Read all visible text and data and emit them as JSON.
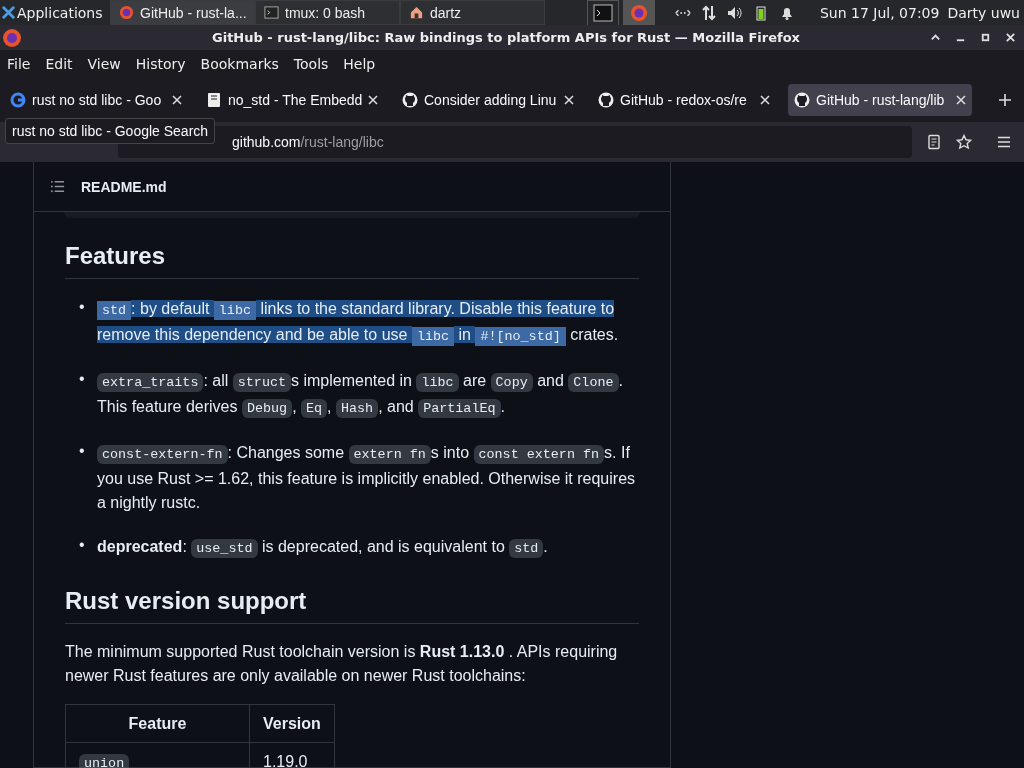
{
  "taskbar": {
    "apps_label": "Applications",
    "tasks": [
      {
        "title": "GitHub - rust-la...",
        "selected": true
      },
      {
        "title": "tmux: 0 bash",
        "selected": false
      },
      {
        "title": "dartz",
        "selected": false
      }
    ],
    "clock": "Sun 17 Jul, 07:09",
    "user": "Darty uwu"
  },
  "window": {
    "title": "GitHub - rust-lang/libc: Raw bindings to platform APIs for Rust — Mozilla Firefox"
  },
  "menu": [
    "File",
    "Edit",
    "View",
    "History",
    "Bookmarks",
    "Tools",
    "Help"
  ],
  "tabs": [
    {
      "title": "rust no std libc - Goo",
      "selected": false
    },
    {
      "title": "no_std - The Embedd",
      "selected": false
    },
    {
      "title": "Consider adding Linu",
      "selected": false
    },
    {
      "title": "GitHub - redox-os/re",
      "selected": false
    },
    {
      "title": "GitHub - rust-lang/lib",
      "selected": true
    }
  ],
  "tooltip": "rust no std libc - Google Search",
  "address": {
    "host": "github.com",
    "path": "/rust-lang/libc"
  },
  "readme": {
    "file": "README.md",
    "features_heading": "Features",
    "features": [
      {
        "bullet": "•",
        "selected": true,
        "parts": [
          {
            "kind": "code",
            "text": "std"
          },
          {
            "kind": "text",
            "text": ": by default "
          },
          {
            "kind": "code",
            "text": "libc"
          },
          {
            "kind": "text",
            "text": " links to the standard library. Disable this feature to remove this dependency and be able to use "
          },
          {
            "kind": "code",
            "text": "libc"
          },
          {
            "kind": "text",
            "text": " in "
          },
          {
            "kind": "code",
            "text": "#![no_std]"
          },
          {
            "kind": "plain",
            "text": " crates."
          }
        ]
      },
      {
        "bullet": "•",
        "selected": false,
        "parts": [
          {
            "kind": "code",
            "text": "extra_traits"
          },
          {
            "kind": "text",
            "text": ": all "
          },
          {
            "kind": "code",
            "text": "struct"
          },
          {
            "kind": "text",
            "text": "s implemented in "
          },
          {
            "kind": "code",
            "text": "libc"
          },
          {
            "kind": "text",
            "text": " are "
          },
          {
            "kind": "code",
            "text": "Copy"
          },
          {
            "kind": "text",
            "text": " and "
          },
          {
            "kind": "code",
            "text": "Clone"
          },
          {
            "kind": "text",
            "text": ". This feature derives "
          },
          {
            "kind": "code",
            "text": "Debug"
          },
          {
            "kind": "text",
            "text": ", "
          },
          {
            "kind": "code",
            "text": "Eq"
          },
          {
            "kind": "text",
            "text": ", "
          },
          {
            "kind": "code",
            "text": "Hash"
          },
          {
            "kind": "text",
            "text": ", and "
          },
          {
            "kind": "code",
            "text": "PartialEq"
          },
          {
            "kind": "text",
            "text": "."
          }
        ]
      },
      {
        "bullet": "•",
        "selected": false,
        "parts": [
          {
            "kind": "code",
            "text": "const-extern-fn"
          },
          {
            "kind": "text",
            "text": ": Changes some "
          },
          {
            "kind": "code",
            "text": "extern fn"
          },
          {
            "kind": "text",
            "text": "s into "
          },
          {
            "kind": "code",
            "text": "const extern fn"
          },
          {
            "kind": "text",
            "text": "s. If you use Rust >= 1.62, this feature is implicitly enabled. Otherwise it requires a nightly rustc."
          }
        ]
      },
      {
        "bullet": "•",
        "selected": false,
        "parts": [
          {
            "kind": "bold",
            "text": "deprecated"
          },
          {
            "kind": "text",
            "text": ": "
          },
          {
            "kind": "code",
            "text": "use_std"
          },
          {
            "kind": "text",
            "text": " is deprecated, and is equivalent to "
          },
          {
            "kind": "code",
            "text": "std"
          },
          {
            "kind": "text",
            "text": "."
          }
        ]
      }
    ],
    "version_heading": "Rust version support",
    "version_text": "The minimum supported Rust toolchain version is **Rust 1.13.0** . APIs requiring newer Rust features are only available on newer Rust toolchains:",
    "table": {
      "columns": [
        "Feature",
        "Version"
      ],
      "rows": [
        {
          "feature": "union",
          "version": "1.19.0"
        }
      ]
    }
  }
}
